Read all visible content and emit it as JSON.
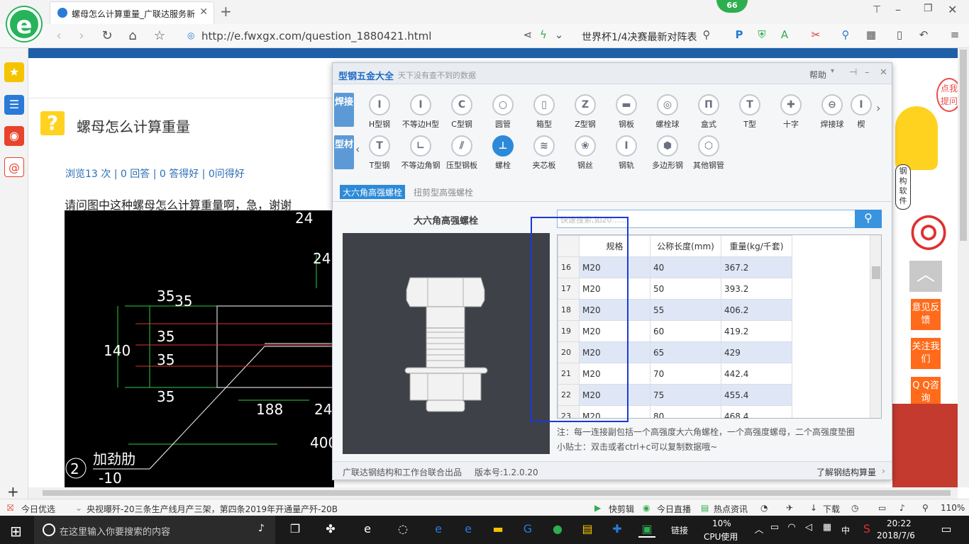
{
  "browser": {
    "tab_title": "螺母怎么计算重量_广联达服务新",
    "url": "http://e.fwxgx.com/question_1880421.html",
    "search_text": "世界杯1/4决赛最新对阵表",
    "badge_count": "66"
  },
  "page": {
    "question_title": "螺母怎么计算重量",
    "stats": "浏览13 次 | 0 回答 | 0 答得好 | 0问得好",
    "question_text": "请问图中这种螺母怎么计算重量啊，急，谢谢",
    "cad_labels": [
      "24",
      "24",
      "35",
      "35",
      "35",
      "35",
      "35",
      "140",
      "188",
      "24",
      "400",
      "加劲肋",
      "-10",
      "2"
    ]
  },
  "right_ads": {
    "feedback": "意见反馈",
    "follow": "关注我们",
    "qq": "Q Q咨询",
    "mascot_text": "钢构软件",
    "bubble_text": "点我提问"
  },
  "dialog": {
    "title": "型钢五金大全",
    "subtitle": "天下没有查不到的数据",
    "help": "帮助",
    "side_tabs": [
      "焊接",
      "型材"
    ],
    "row1": [
      "H型钢",
      "不等边H型",
      "C型钢",
      "圆管",
      "箱型",
      "Z型钢",
      "钢板",
      "螺栓球",
      "盒式",
      "T型",
      "十字",
      "焊接球",
      "楔"
    ],
    "row2": [
      "T型钢",
      "不等边角钢",
      "压型钢板",
      "螺栓",
      "夹芯板",
      "钢丝",
      "钢轨",
      "多边形钢",
      "其他钢管"
    ],
    "selected_item": "螺栓",
    "subtab_active": "大六角高强螺栓",
    "subtab_inactive": "扭剪型高强螺栓",
    "product_name": "大六角高强螺栓",
    "search_placeholder": "快速搜索,如20......",
    "columns": [
      "规格",
      "公称长度(mm)",
      "重量(kg/千套)"
    ],
    "rows": [
      {
        "n": "16",
        "spec": "M20",
        "len": "40",
        "wt": "367.2"
      },
      {
        "n": "17",
        "spec": "M20",
        "len": "50",
        "wt": "393.2"
      },
      {
        "n": "18",
        "spec": "M20",
        "len": "55",
        "wt": "406.2"
      },
      {
        "n": "19",
        "spec": "M20",
        "len": "60",
        "wt": "419.2"
      },
      {
        "n": "20",
        "spec": "M20",
        "len": "65",
        "wt": "429"
      },
      {
        "n": "21",
        "spec": "M20",
        "len": "70",
        "wt": "442.4"
      },
      {
        "n": "22",
        "spec": "M20",
        "len": "75",
        "wt": "455.4"
      },
      {
        "n": "23",
        "spec": "M20",
        "len": "80",
        "wt": "468.4"
      }
    ],
    "note": "注：每一连接副包括一个高强度大六角螺栓，一个高强度螺母，二个高强度垫圈",
    "tip": "小贴士：双击或者ctrl+c可以复制数据哦~",
    "footer_left": "广联达钢结构和工作台联合出品",
    "version": "版本号:1.2.0.20",
    "footer_right": "了解钢结构算量"
  },
  "statusbar": {
    "today": "今日优选",
    "news": "央视曝歼-20三条生产线月产三架，第四条2019年开通量产歼-20B",
    "quick_cut": "快剪辑",
    "live": "今日直播",
    "hot": "热点资讯",
    "download": "下载",
    "zoom": "110%"
  },
  "taskbar": {
    "search_placeholder": "在这里输入你要搜索的内容",
    "link": "链接",
    "cpu_pct": "10%",
    "cpu_label": "CPU使用",
    "ime": "中",
    "time": "20:22",
    "date": "2018/7/6"
  }
}
